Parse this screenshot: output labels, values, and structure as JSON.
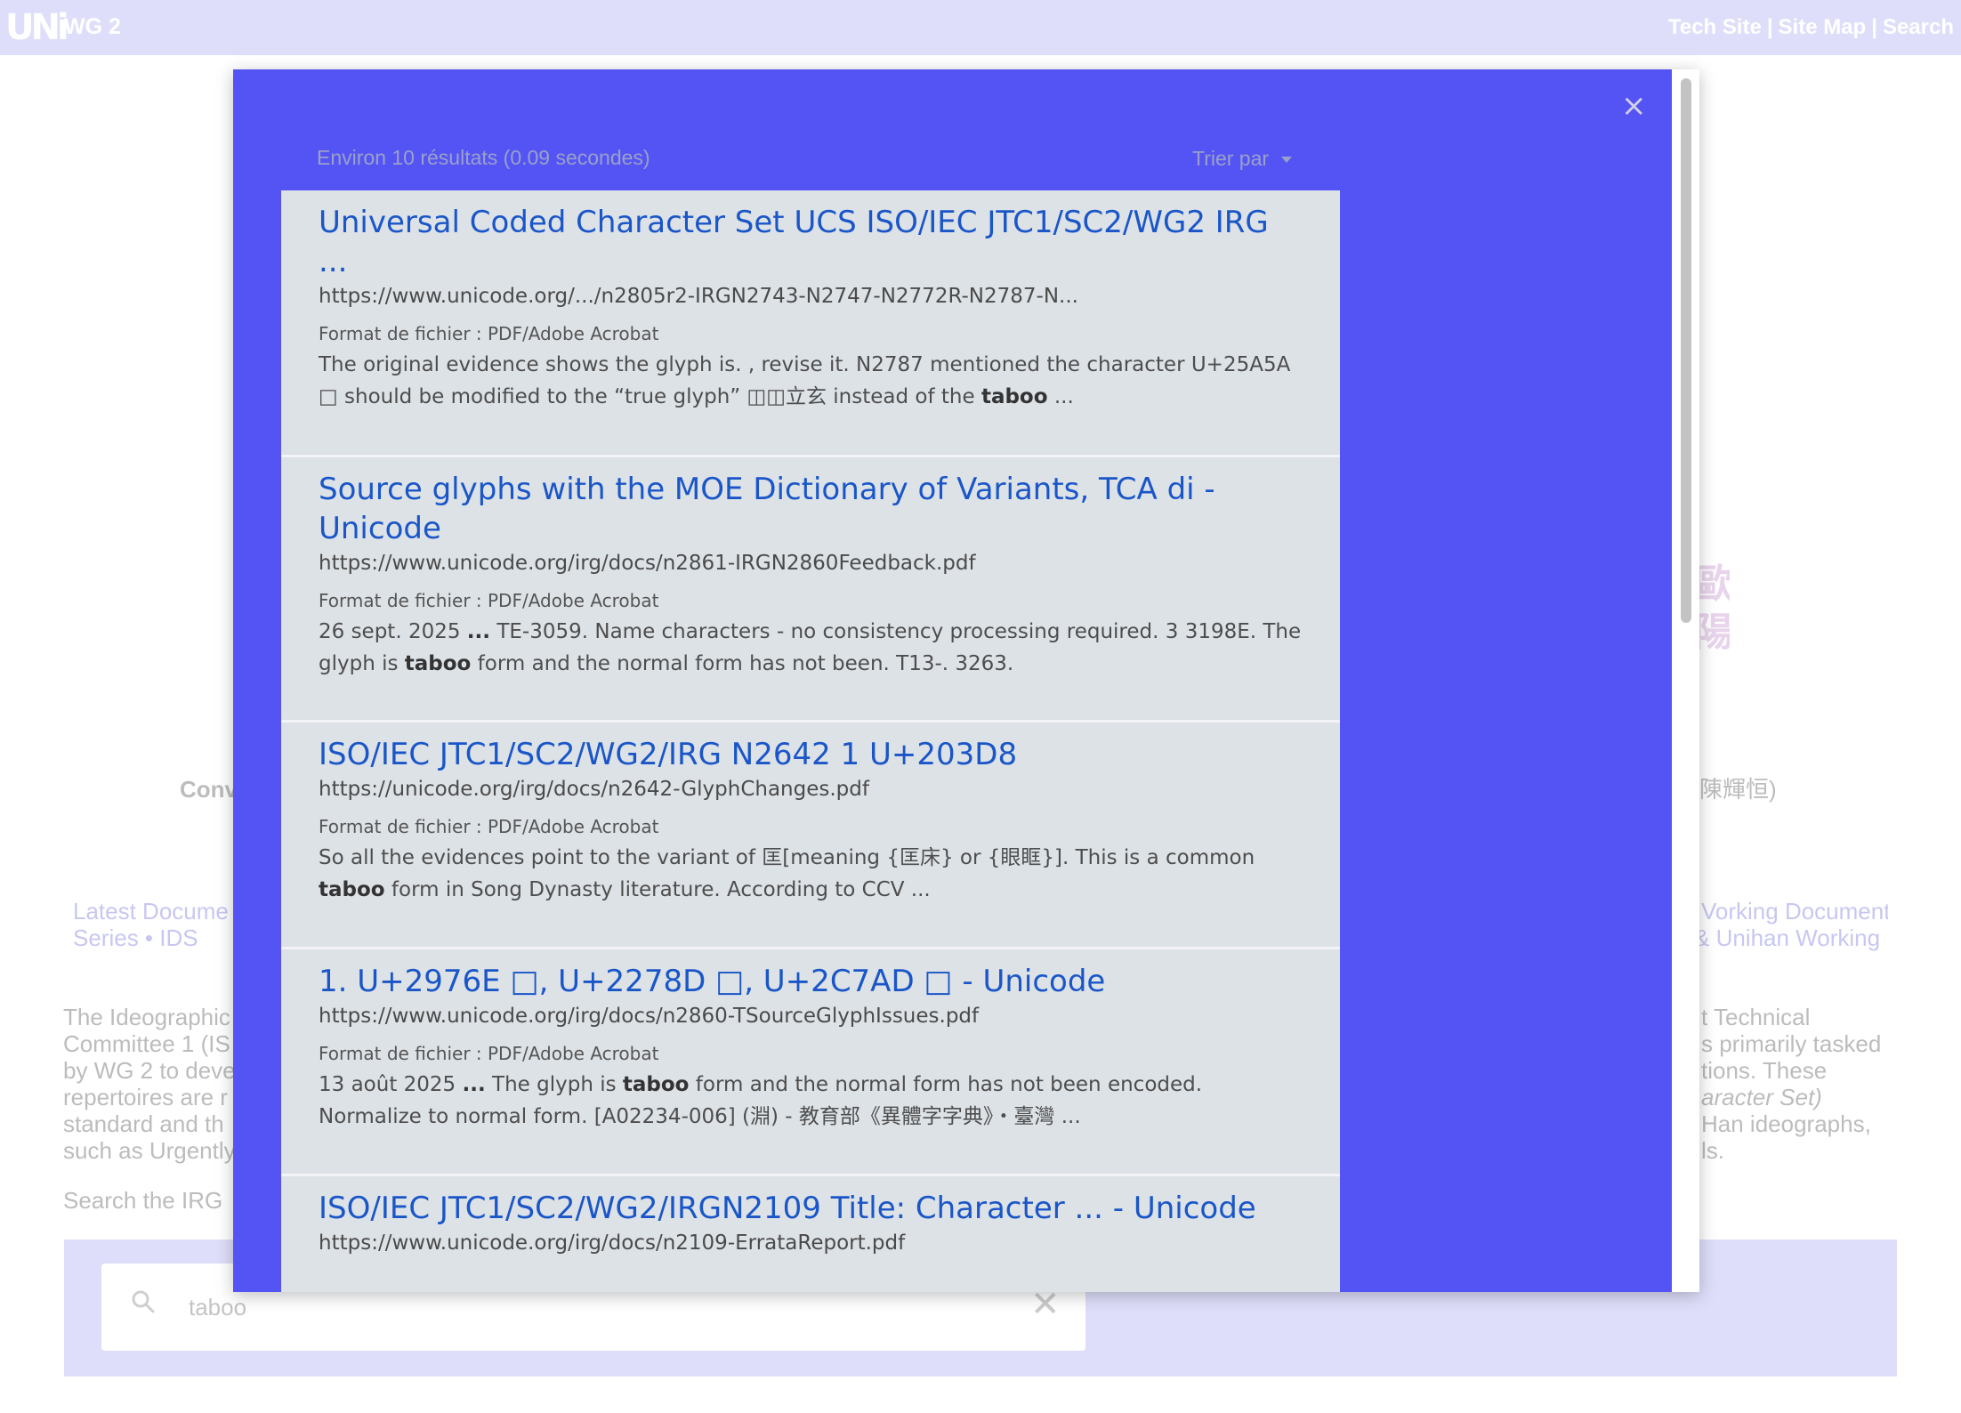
{
  "header": {
    "logo": "UNi",
    "title": "WG 2",
    "links": [
      "Tech Site",
      "Site Map",
      "Search"
    ]
  },
  "background": {
    "left_fragments": {
      "conv": "Conv",
      "latest": "Latest Docume",
      "series": "Series  •  IDS",
      "p1": "The Ideographic",
      "p2": "Committee 1 (IS",
      "p3": "by WG 2 to deve",
      "p4": "repertoires are r",
      "p5": "standard and th",
      "p6": "such as Urgently",
      "search_label": "Search the IRG"
    },
    "right_fragments": {
      "name": "陳輝恒)",
      "link1": "Vorking Document",
      "link2": "& Unihan Working",
      "p1": "t Technical",
      "p2": "s primarily tasked",
      "p3": "tions. These",
      "p4": "aracter Set)",
      "p5": "Han ideographs,",
      "p6": "ls."
    },
    "cjk_glyphs": "歐陽",
    "search": {
      "value": "taboo"
    }
  },
  "modal": {
    "close": "×",
    "stats": "Environ 10 résultats (0.09 secondes)",
    "sort_label": "Trier par",
    "results": [
      {
        "title": "Universal Coded Character Set UCS ISO/IEC JTC1/SC2/WG2 IRG ...",
        "url": "https://www.unicode.org/.../n2805r2-IRGN2743-N2747-N2772R-N2787-N...",
        "format": "Format de fichier : PDF/Adobe Acrobat",
        "snippet_html": "The original evidence shows the glyph is. , revise it. N2787 mentioned the character U+25A5A □ should be modified to the “true glyph” ◫◫立玄 instead of the <b>taboo</b> ..."
      },
      {
        "title": "Source glyphs with the MOE Dictionary of Variants, TCA di - Unicode",
        "url": "https://www.unicode.org/irg/docs/n2861-IRGN2860Feedback.pdf",
        "format": "Format de fichier : PDF/Adobe Acrobat",
        "snippet_html": "26 sept. 2025 <b>...</b> TE-3059. Name characters - no consistency processing required. 3 3198E. The glyph is <b>taboo</b> form and the normal form has not been. T13-. 3263."
      },
      {
        "title": "ISO/IEC JTC1/SC2/WG2/IRG N2642 1 U+203D8",
        "url": "https://unicode.org/irg/docs/n2642-GlyphChanges.pdf",
        "format": "Format de fichier : PDF/Adobe Acrobat",
        "snippet_html": "So all the evidences point to the variant of 匡[meaning {匡床} or {眼眶}]. This is a common <b>taboo</b> form in Song Dynasty literature. According to CCV ..."
      },
      {
        "title": "1. U+2976E □, U+2278D □, U+2C7AD □ - Unicode",
        "url": "https://www.unicode.org/irg/docs/n2860-TSourceGlyphIssues.pdf",
        "format": "Format de fichier : PDF/Adobe Acrobat",
        "snippet_html": "13 août 2025 <b>...</b> The glyph is <b>taboo</b> form and the normal form has not been encoded. Normalize to normal form. [A02234-006] (淵) - 教育部《異體字字典》・臺灣 ..."
      },
      {
        "title": "ISO/IEC JTC1/SC2/WG2/IRGN2109 Title: Character ... - Unicode",
        "url": "https://www.unicode.org/irg/docs/n2109-ErrataReport.pdf",
        "format": "",
        "snippet_html": ""
      }
    ]
  }
}
